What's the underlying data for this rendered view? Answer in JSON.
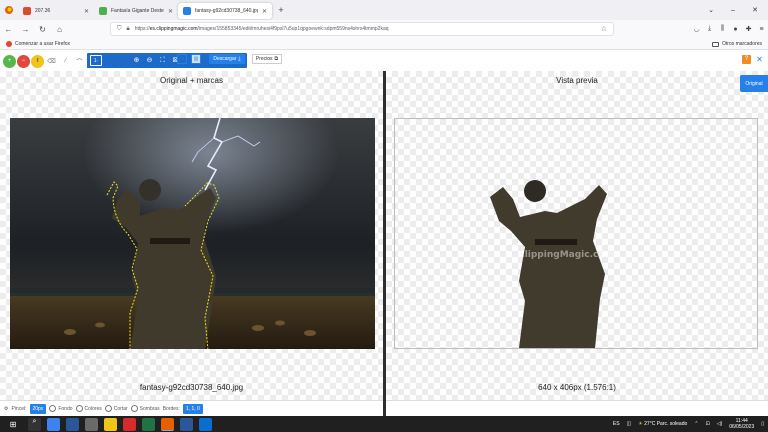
{
  "browser": {
    "tabs": [
      {
        "title": "207.36",
        "favicon_color": "#e0482c"
      },
      {
        "title": "Fantasía Gigante Destello - Imag",
        "favicon_color": "#4caf50"
      },
      {
        "title": "fantasy-g92cd30738_640.jpg - C",
        "favicon_color": "#2680eb"
      }
    ],
    "url_prefix": "https://",
    "url_domain": "es.clippingmagic.com",
    "url_path": "/images/155853345/edit/mruhesi4f9psl7u5up1qpgoewnk:sdpm559ns4shrx4tmmp2kaq",
    "bookmark": "Comenzar a usar Firefox",
    "other_bookmarks": "Otros marcadores"
  },
  "toolbar": {
    "brush_label": "1·",
    "descargar": "Descargar",
    "precios": "Precios"
  },
  "panes": {
    "left_title": "Original + marcas",
    "right_title": "Vista previa",
    "left_footer": "fantasy-g92cd30738_640.jpg",
    "right_footer": "640 x 406px (1.576:1)",
    "side_tab": "Original",
    "watermark": "ClippingMagic.com"
  },
  "bottom": {
    "pincel_label": "Pincel:",
    "pincel_value": "20px",
    "fondo": "Fondo",
    "colores": "Colores",
    "cortar": "Cortar",
    "sombras": "Sombras",
    "bordes_label": "Bordes:",
    "bordes_value": "1, 1, 0"
  },
  "taskbar": {
    "weather": "27°C  Parc. soleado",
    "lang": "ES",
    "time": "11:44",
    "date": "06/05/2023"
  },
  "colors": {
    "accent": "#2680eb",
    "toolbox_bg": "#1e6ac8",
    "outline": "#f3e21c"
  }
}
